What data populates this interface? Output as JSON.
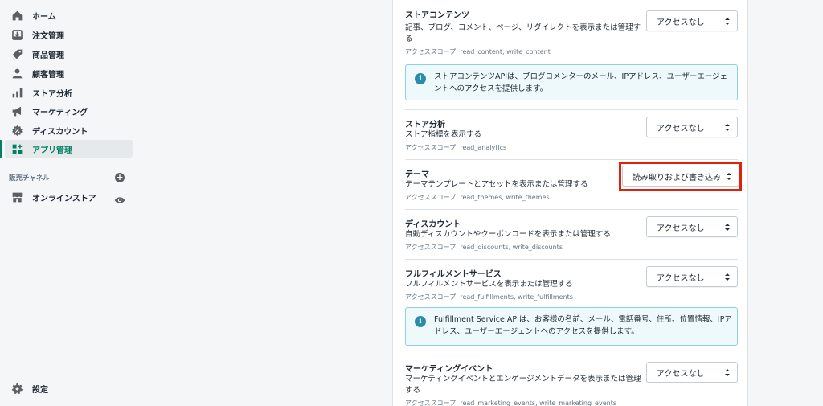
{
  "sidebar": {
    "items": [
      {
        "label": "ホーム",
        "icon": "home-icon"
      },
      {
        "label": "注文管理",
        "icon": "orders-icon"
      },
      {
        "label": "商品管理",
        "icon": "tag-icon"
      },
      {
        "label": "顧客管理",
        "icon": "person-icon"
      },
      {
        "label": "ストア分析",
        "icon": "analytics-icon"
      },
      {
        "label": "マーケティング",
        "icon": "megaphone-icon"
      },
      {
        "label": "ディスカウント",
        "icon": "discount-icon"
      },
      {
        "label": "アプリ管理",
        "icon": "apps-icon",
        "active": true
      }
    ],
    "sales_channels_title": "販売チャネル",
    "online_store_label": "オンラインストア",
    "settings_label": "設定"
  },
  "permissions": [
    {
      "title": "ストアコンテンツ",
      "description": "記事、ブログ、コメント、ページ、リダイレクトを表示または管理する",
      "scope": "アクセススコープ: read_content, write_content",
      "value": "アクセスなし"
    },
    {
      "title": "ストア分析",
      "description": "ストア指標を表示する",
      "scope": "アクセススコープ: read_analytics",
      "value": "アクセスなし"
    },
    {
      "title": "テーマ",
      "description": "テーマテンプレートとアセットを表示または管理する",
      "scope": "アクセススコープ: read_themes, write_themes",
      "value": "読み取りおよび書き込み"
    },
    {
      "title": "ディスカウント",
      "description": "自動ディスカウントやクーポンコードを表示または管理する",
      "scope": "アクセススコープ: read_discounts, write_discounts",
      "value": "アクセスなし"
    },
    {
      "title": "フルフィルメントサービス",
      "description": "フルフィルメントサービスを表示または管理する",
      "scope": "アクセススコープ: read_fulfillments, write_fulfillments",
      "value": "アクセスなし"
    },
    {
      "title": "マーケティングイベント",
      "description": "マーケティングイベントとエンゲージメントデータを表示または管理する",
      "scope": "アクセススコープ: read_marketing_events, write_marketing_events",
      "value": "アクセスなし"
    }
  ],
  "banners": {
    "content": "ストアコンテンツAPIは、ブログコメンターのメール、IPアドレス、ユーザーエージェントへのアクセスを提供します。",
    "fulfillment": "Fulfillment Service APIは、お客様の名前、メール、電話番号、住所、位置情報、IPアドレス、ユーザーエージェントへのアクセスを提供します。"
  },
  "colors": {
    "accent": "#008060",
    "highlight_frame": "#e3200c",
    "info_banner_bg": "#eef9fb",
    "info_icon": "#2a8ca8"
  }
}
